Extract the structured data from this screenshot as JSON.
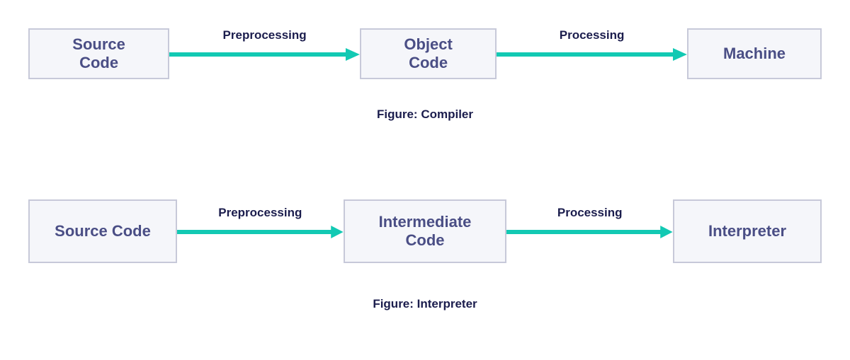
{
  "colors": {
    "arrow": "#12c9b3",
    "label": "#1b1d4d",
    "node_text": "#4a4e85",
    "node_border": "#c7c9d9",
    "node_bg": "#f5f6fa"
  },
  "flow1": {
    "node1": "Source Code",
    "arrow1_label": "Preprocessing",
    "node2": "Object Code",
    "arrow2_label": "Processing",
    "node3": "Machine",
    "caption": "Figure: Compiler"
  },
  "flow2": {
    "node1": "Source Code",
    "arrow1_label": "Preprocessing",
    "node2": "Intermediate Code",
    "arrow2_label": "Processing",
    "node3": "Interpreter",
    "caption": "Figure: Interpreter"
  }
}
